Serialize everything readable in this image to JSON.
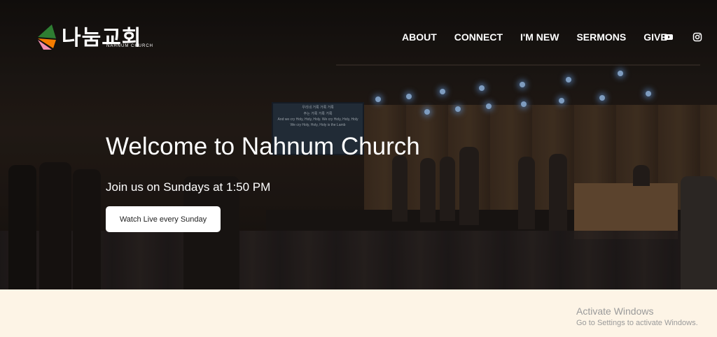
{
  "brand": {
    "name_korean": "나눔교회",
    "name_english": "NAHNUM CHURCH",
    "colors": {
      "green": "#2e7d32",
      "orange": "#f57c00",
      "pink": "#f48fb1"
    }
  },
  "nav": {
    "items": [
      {
        "label": "ABOUT"
      },
      {
        "label": "CONNECT"
      },
      {
        "label": "I'M NEW"
      },
      {
        "label": "SERMONS"
      },
      {
        "label": "GIVE"
      }
    ],
    "social_icons": [
      "youtube-icon",
      "instagram-icon"
    ]
  },
  "hero": {
    "title": "Welcome to Nahnum Church",
    "subtitle": "Join us on Sundays at 1:50 PM",
    "button_label": "Watch Live every Sunday",
    "screen_lines": [
      "우리네 거룩 거룩 거룩",
      "주는 거룩 거룩 거룩",
      "And we cry Holy, Holy, Holy. We cry Holy, Holy, Holy",
      "We cry Holy, Holy, Holy is the Lamb"
    ]
  },
  "footer_band": {
    "color": "#fdf4e6"
  },
  "windows_watermark": {
    "line1": "Activate Windows",
    "line2": "Go to Settings to activate Windows."
  }
}
